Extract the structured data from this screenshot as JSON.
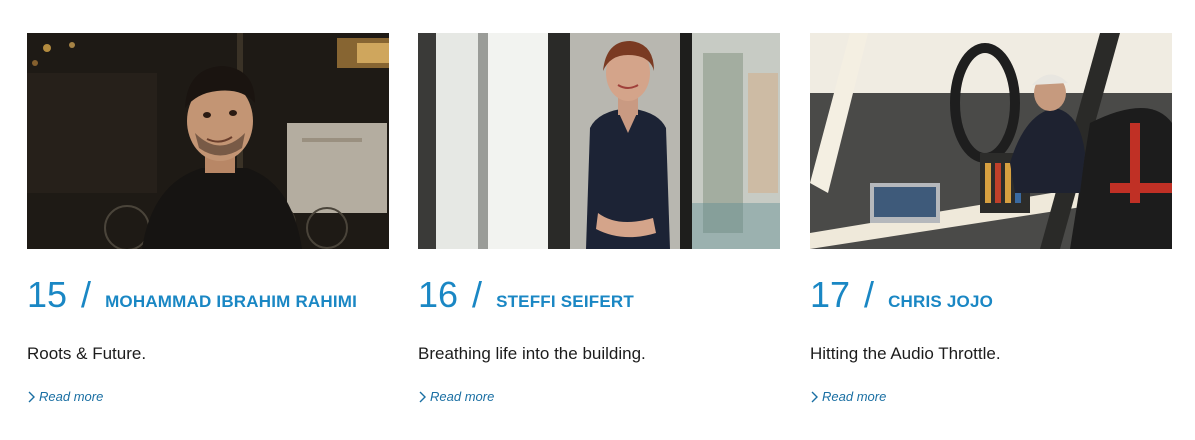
{
  "cards": [
    {
      "number": "15",
      "separator": "/",
      "name": "MOHAMMAD IBRAHIM RAHIMI",
      "tagline": "Roots & Future.",
      "read_more": "Read more"
    },
    {
      "number": "16",
      "separator": "/",
      "name": "STEFFI SEIFERT",
      "tagline": "Breathing life into the building.",
      "read_more": "Read more"
    },
    {
      "number": "17",
      "separator": "/",
      "name": "CHRIS JOJO",
      "tagline": "Hitting the Audio Throttle.",
      "read_more": "Read more"
    }
  ],
  "colors": {
    "accent": "#1a87c4",
    "link": "#1a6fa3",
    "text": "#1c1c1c"
  },
  "icons": {
    "read_more": "chevron-right-icon"
  }
}
